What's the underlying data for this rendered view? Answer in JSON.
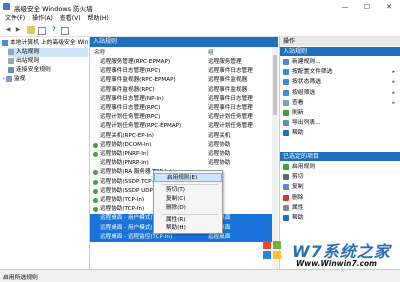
{
  "window": {
    "title": "高级安全 Windows 防火墙",
    "min": "—",
    "max": "☐",
    "close": "✕"
  },
  "menu": [
    "文件(F)",
    "操作(A)",
    "查看(V)",
    "帮助(H)"
  ],
  "toolbar_icons": [
    "back-icon",
    "forward-icon",
    "up-folder-icon",
    "show-hide-icon",
    "help-icon",
    "properties-icon"
  ],
  "tree": {
    "root": "本地计算机 上的高级安全 Win",
    "items": [
      "入站规则",
      "出站规则",
      "连接安全规则",
      "监视"
    ]
  },
  "center": {
    "header": "入站规则",
    "col_name": "名称",
    "col_group": "组",
    "rows": [
      {
        "name": "远程服务管理(RPC-EPMAP)",
        "group": "远程服务管理",
        "enabled": false,
        "selected": false
      },
      {
        "name": "远程事件日志管理(RPC)",
        "group": "远程事件日志管理",
        "enabled": false,
        "selected": false
      },
      {
        "name": "远程事件监视器(RPC-EPMAP)",
        "group": "远程事件监视器",
        "enabled": false,
        "selected": false
      },
      {
        "name": "远程事件监视器(RPC)",
        "group": "远程事件监视器",
        "enabled": false,
        "selected": false
      },
      {
        "name": "远程事件日志管理(NP-In)",
        "group": "远程事件日志管理",
        "enabled": false,
        "selected": false
      },
      {
        "name": "远程事件日志管理(RPC)",
        "group": "远程事件日志管理",
        "enabled": false,
        "selected": false
      },
      {
        "name": "远程计划任务管理(RPC)",
        "group": "远程计划任务管理",
        "enabled": false,
        "selected": false
      },
      {
        "name": "远程计划任务管理(RPC-EPMAP)",
        "group": "远程计划任务管理",
        "enabled": false,
        "selected": false
      },
      {
        "name": "远程关机(RPC-EP-In)",
        "group": "远程关机",
        "enabled": false,
        "selected": false
      },
      {
        "name": "远程协助(DCOM-In)",
        "group": "远程协助",
        "enabled": true,
        "selected": false
      },
      {
        "name": "远程协助(PNRP-In)",
        "group": "远程协助",
        "enabled": true,
        "selected": false
      },
      {
        "name": "远程协助(PNRP-In)",
        "group": "远程协助",
        "enabled": false,
        "selected": false
      },
      {
        "name": "远程协助(RA 服务器 TCP-In)",
        "group": "",
        "enabled": true,
        "selected": false
      },
      {
        "name": "远程协助(SSDP TCP-In)",
        "group": "",
        "enabled": true,
        "selected": false
      },
      {
        "name": "远程协助(SSDP UDP-In)",
        "group": "",
        "enabled": true,
        "selected": false
      },
      {
        "name": "远程协助(TCP-In)",
        "group": "",
        "enabled": true,
        "selected": false
      },
      {
        "name": "远程协助(TCP-In)",
        "group": "",
        "enabled": true,
        "selected": false
      },
      {
        "name": "远程桌面 - 用户模式(TCP-In)",
        "group": "远程桌面",
        "enabled": false,
        "selected": true
      },
      {
        "name": "远程桌面 - 用户模式(UDP-In)",
        "group": "远程桌面",
        "enabled": false,
        "selected": true
      },
      {
        "name": "远程桌面 - 远程监控(TCP-In)",
        "group": "远程桌面",
        "enabled": false,
        "selected": true
      }
    ]
  },
  "context_menu": [
    "启用规则(E)",
    "剪切(T)",
    "复制(C)",
    "删除(D)",
    "属性(R)",
    "帮助(H)"
  ],
  "actions": {
    "header": "操作",
    "section1": "入站规则",
    "items1": [
      {
        "label": "新建规则...",
        "icon": "new-rule-icon",
        "arrow": ""
      },
      {
        "label": "按配置文件筛选",
        "icon": "filter-icon",
        "arrow": "▸"
      },
      {
        "label": "按状态筛选",
        "icon": "filter-icon",
        "arrow": "▸"
      },
      {
        "label": "按组筛选",
        "icon": "filter-icon",
        "arrow": "▸"
      },
      {
        "label": "查看",
        "icon": "view-icon",
        "arrow": "▸"
      },
      {
        "label": "刷新",
        "icon": "refresh-icon",
        "arrow": ""
      },
      {
        "label": "导出列表...",
        "icon": "export-icon",
        "arrow": ""
      },
      {
        "label": "帮助",
        "icon": "help-icon",
        "arrow": ""
      }
    ],
    "section2": "已选定的项目",
    "items2": [
      {
        "label": "启用规则",
        "icon": "enable-icon",
        "arrow": ""
      },
      {
        "label": "剪切",
        "icon": "cut-icon",
        "arrow": ""
      },
      {
        "label": "复制",
        "icon": "copy-icon",
        "arrow": ""
      },
      {
        "label": "删除",
        "icon": "delete-icon",
        "arrow": ""
      },
      {
        "label": "属性",
        "icon": "properties-icon",
        "arrow": ""
      },
      {
        "label": "帮助",
        "icon": "help-icon",
        "arrow": ""
      }
    ]
  },
  "status": "启用所选规则",
  "watermark": {
    "text1": "W7系统之家",
    "text2": "Www.Winwin7.com"
  },
  "colors": {
    "accent": "#1e6fbf",
    "selection": "#1a73d8",
    "enabled": "#3aa33a"
  }
}
